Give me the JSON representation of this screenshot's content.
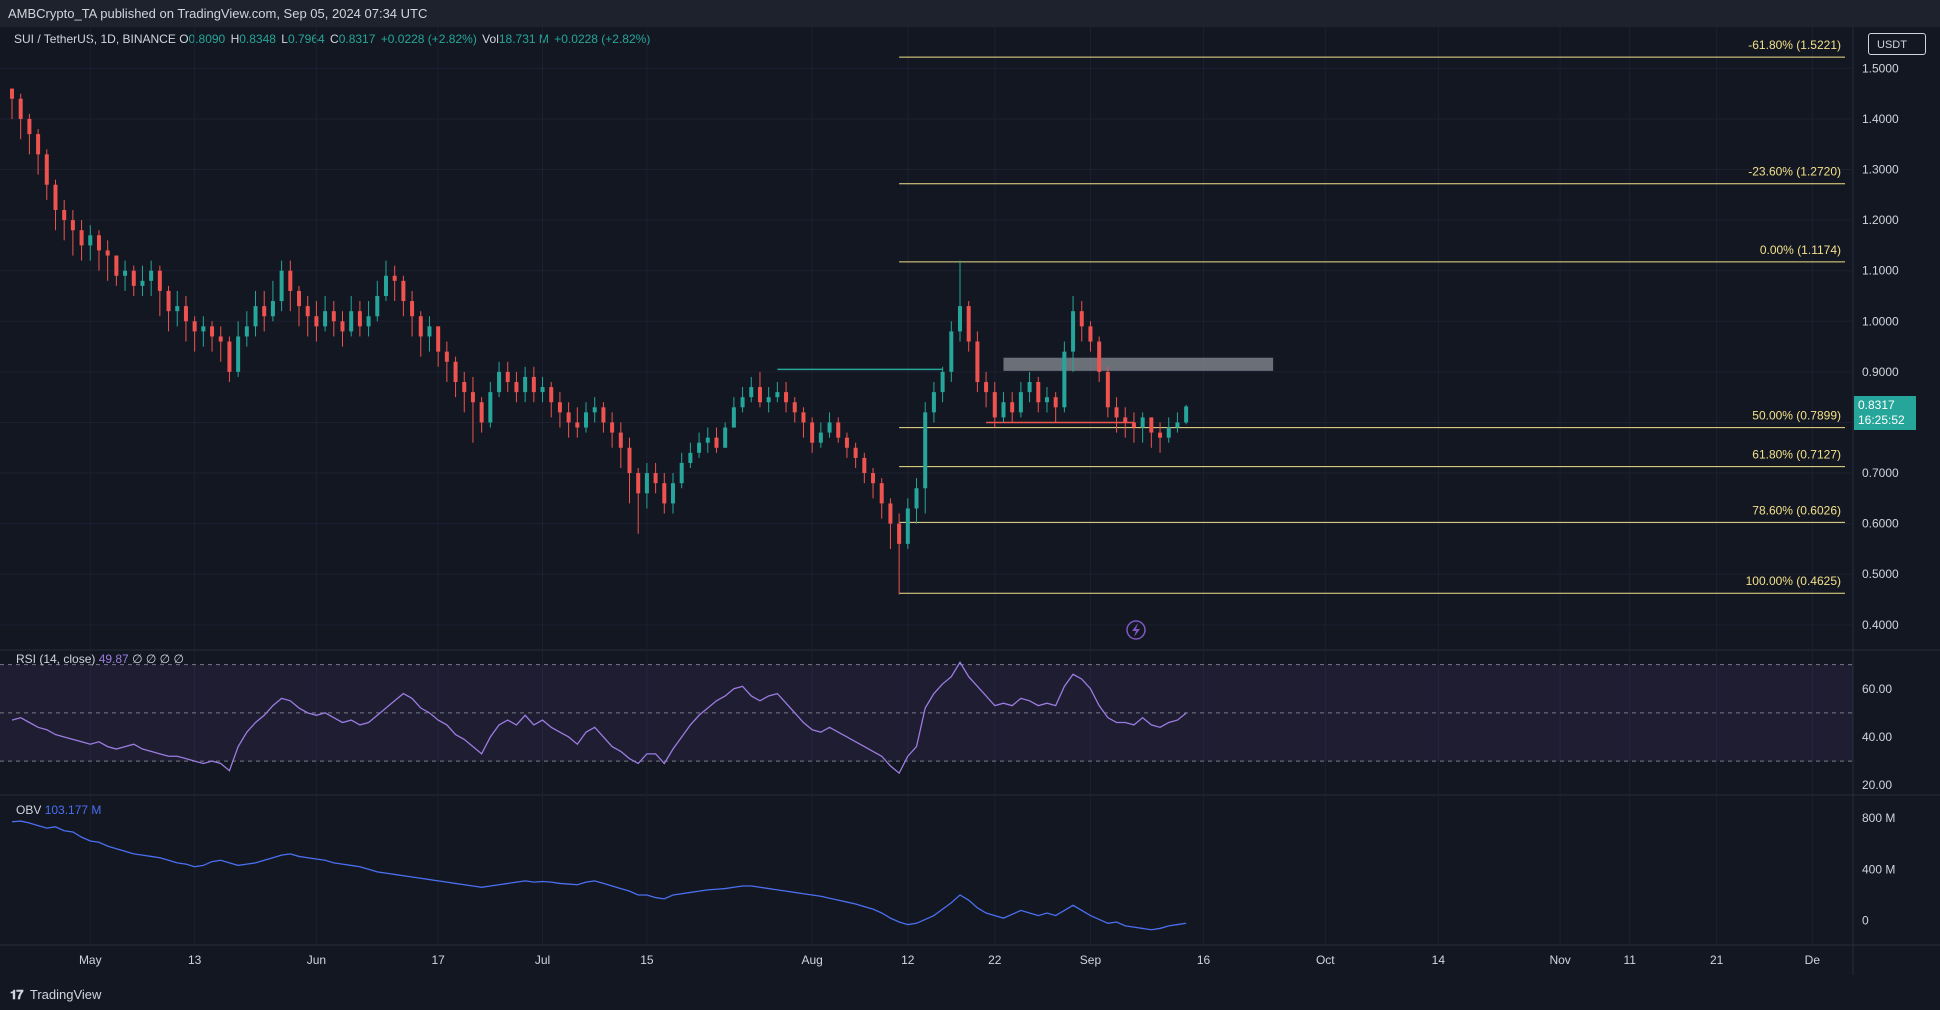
{
  "header": {
    "publisher_line": "AMBCrypto_TA published on TradingView.com, Sep 05, 2024 07:34 UTC"
  },
  "symbol": {
    "name": "SUI / TetherUS, 1D, BINANCE",
    "open_label": "O",
    "open": "0.8090",
    "high_label": "H",
    "high": "0.8348",
    "low_label": "L",
    "low": "0.7964",
    "close_label": "C",
    "close": "0.8317",
    "change": "+0.0228 (+2.82%)",
    "vol_label": "Vol",
    "volume": "18.731 M",
    "vol_change": "+0.0228 (+2.82%)"
  },
  "currency_button": "USDT",
  "last_price": {
    "price": "0.8317",
    "countdown": "16:25:52"
  },
  "rsi": {
    "label": "RSI (14, close)",
    "value": "49.87",
    "extra": "∅ ∅ ∅ ∅"
  },
  "obv": {
    "label": "OBV",
    "value": "103.177 M"
  },
  "footer": {
    "brand": "TradingView",
    "logo_glyph": "𝟏𝟕"
  },
  "colors": {
    "background": "#131722",
    "up": "#26a69a",
    "down": "#ef5350",
    "fib": "#f2e08a",
    "rsi": "#9b7ce0",
    "obv": "#4a6ff0"
  },
  "chart_data": {
    "type": "candlestick",
    "price_axis": {
      "ylim": [
        0.37,
        1.56
      ],
      "ticks": [
        "0.4000",
        "0.5000",
        "0.6000",
        "0.7000",
        "0.8000",
        "0.9000",
        "1.0000",
        "1.1000",
        "1.2000",
        "1.3000",
        "1.4000",
        "1.5000"
      ]
    },
    "time_axis": {
      "xlim": [
        0,
        200
      ],
      "ticks": [
        {
          "t": 9,
          "label": "May"
        },
        {
          "t": 21,
          "label": "13"
        },
        {
          "t": 35,
          "label": "Jun"
        },
        {
          "t": 49,
          "label": "17"
        },
        {
          "t": 61,
          "label": "Jul"
        },
        {
          "t": 73,
          "label": "15"
        },
        {
          "t": 92,
          "label": "Aug"
        },
        {
          "t": 103,
          "label": "12"
        },
        {
          "t": 113,
          "label": "22"
        },
        {
          "t": 124,
          "label": "Sep"
        },
        {
          "t": 137,
          "label": "16"
        },
        {
          "t": 151,
          "label": "Oct"
        },
        {
          "t": 164,
          "label": "14"
        },
        {
          "t": 178,
          "label": "Nov"
        },
        {
          "t": 186,
          "label": "11"
        },
        {
          "t": 196,
          "label": "21"
        },
        {
          "t": 207,
          "label": "De"
        }
      ]
    },
    "close": [
      1.44,
      1.4,
      1.37,
      1.33,
      1.27,
      1.22,
      1.2,
      1.18,
      1.15,
      1.17,
      1.14,
      1.13,
      1.09,
      1.1,
      1.07,
      1.08,
      1.1,
      1.06,
      1.02,
      1.03,
      1.0,
      0.98,
      0.99,
      0.97,
      0.96,
      0.9,
      0.97,
      0.99,
      1.03,
      1.01,
      1.04,
      1.1,
      1.06,
      1.03,
      1.01,
      0.99,
      1.02,
      1.0,
      0.98,
      1.02,
      0.99,
      1.01,
      1.05,
      1.09,
      1.08,
      1.04,
      1.01,
      0.97,
      0.99,
      0.94,
      0.92,
      0.88,
      0.86,
      0.84,
      0.8,
      0.86,
      0.9,
      0.88,
      0.86,
      0.89,
      0.86,
      0.87,
      0.84,
      0.82,
      0.8,
      0.79,
      0.82,
      0.83,
      0.8,
      0.78,
      0.75,
      0.7,
      0.66,
      0.7,
      0.68,
      0.64,
      0.68,
      0.72,
      0.74,
      0.76,
      0.77,
      0.75,
      0.79,
      0.83,
      0.85,
      0.87,
      0.84,
      0.85,
      0.86,
      0.84,
      0.82,
      0.8,
      0.76,
      0.78,
      0.8,
      0.77,
      0.75,
      0.73,
      0.7,
      0.68,
      0.64,
      0.6,
      0.56,
      0.63,
      0.67,
      0.82,
      0.86,
      0.9,
      0.98,
      1.03,
      0.96,
      0.88,
      0.86,
      0.81,
      0.84,
      0.82,
      0.86,
      0.88,
      0.84,
      0.85,
      0.83,
      0.94,
      1.02,
      0.99,
      0.96,
      0.9,
      0.83,
      0.81,
      0.8,
      0.79,
      0.81,
      0.78,
      0.77,
      0.79,
      0.8,
      0.8317
    ],
    "high": [
      1.46,
      1.45,
      1.41,
      1.38,
      1.34,
      1.28,
      1.24,
      1.22,
      1.2,
      1.19,
      1.18,
      1.16,
      1.13,
      1.12,
      1.11,
      1.11,
      1.12,
      1.11,
      1.07,
      1.06,
      1.05,
      1.01,
      1.01,
      1.0,
      0.99,
      0.97,
      1.0,
      1.02,
      1.06,
      1.06,
      1.08,
      1.12,
      1.12,
      1.07,
      1.05,
      1.04,
      1.05,
      1.04,
      1.02,
      1.05,
      1.04,
      1.04,
      1.08,
      1.12,
      1.11,
      1.09,
      1.06,
      1.02,
      1.01,
      0.99,
      0.96,
      0.93,
      0.9,
      0.89,
      0.85,
      0.88,
      0.92,
      0.92,
      0.9,
      0.91,
      0.91,
      0.89,
      0.88,
      0.86,
      0.84,
      0.83,
      0.84,
      0.85,
      0.84,
      0.82,
      0.8,
      0.77,
      0.71,
      0.72,
      0.72,
      0.7,
      0.7,
      0.74,
      0.76,
      0.78,
      0.79,
      0.79,
      0.8,
      0.85,
      0.87,
      0.89,
      0.9,
      0.87,
      0.88,
      0.88,
      0.85,
      0.83,
      0.81,
      0.8,
      0.82,
      0.81,
      0.78,
      0.76,
      0.74,
      0.71,
      0.69,
      0.65,
      0.62,
      0.65,
      0.69,
      0.84,
      0.88,
      0.91,
      1.0,
      1.12,
      1.04,
      0.98,
      0.9,
      0.88,
      0.86,
      0.86,
      0.88,
      0.9,
      0.89,
      0.87,
      0.86,
      0.96,
      1.05,
      1.04,
      1.0,
      0.97,
      0.91,
      0.85,
      0.83,
      0.82,
      0.82,
      0.81,
      0.8,
      0.81,
      0.82,
      0.8348
    ],
    "low": [
      1.4,
      1.36,
      1.33,
      1.29,
      1.24,
      1.18,
      1.16,
      1.13,
      1.12,
      1.12,
      1.1,
      1.08,
      1.07,
      1.06,
      1.05,
      1.05,
      1.05,
      1.01,
      0.98,
      0.99,
      0.96,
      0.94,
      0.95,
      0.94,
      0.92,
      0.88,
      0.89,
      0.95,
      0.97,
      0.98,
      1.0,
      1.02,
      1.02,
      0.99,
      0.97,
      0.96,
      0.98,
      0.97,
      0.95,
      0.97,
      0.97,
      0.97,
      1.0,
      1.04,
      1.04,
      1.01,
      0.97,
      0.93,
      0.94,
      0.91,
      0.88,
      0.85,
      0.82,
      0.76,
      0.78,
      0.79,
      0.85,
      0.86,
      0.84,
      0.84,
      0.84,
      0.84,
      0.81,
      0.79,
      0.77,
      0.77,
      0.78,
      0.8,
      0.78,
      0.75,
      0.71,
      0.64,
      0.58,
      0.63,
      0.66,
      0.62,
      0.62,
      0.67,
      0.71,
      0.73,
      0.74,
      0.74,
      0.75,
      0.79,
      0.82,
      0.84,
      0.83,
      0.82,
      0.84,
      0.82,
      0.8,
      0.77,
      0.74,
      0.75,
      0.77,
      0.76,
      0.73,
      0.71,
      0.68,
      0.65,
      0.61,
      0.55,
      0.46,
      0.55,
      0.6,
      0.62,
      0.8,
      0.84,
      0.88,
      0.96,
      0.94,
      0.86,
      0.83,
      0.79,
      0.8,
      0.8,
      0.81,
      0.84,
      0.82,
      0.82,
      0.8,
      0.82,
      0.9,
      0.96,
      0.94,
      0.88,
      0.81,
      0.78,
      0.77,
      0.76,
      0.76,
      0.75,
      0.74,
      0.76,
      0.78,
      0.7964
    ],
    "fibonacci": [
      {
        "label": "-61.80% (1.5221)",
        "price": 1.5221
      },
      {
        "label": "-23.60% (1.2720)",
        "price": 1.272
      },
      {
        "label": "0.00% (1.1174)",
        "price": 1.1174
      },
      {
        "label": "50.00% (0.7899)",
        "price": 0.7899
      },
      {
        "label": "61.80% (0.7127)",
        "price": 0.7127
      },
      {
        "label": "78.60% (0.6026)",
        "price": 0.6026
      },
      {
        "label": "100.00% (0.4625)",
        "price": 0.4625
      }
    ],
    "fib_start_t": 102,
    "fib_end_t": 213,
    "supply_zone": {
      "t0": 114,
      "t1": 145,
      "p0": 0.902,
      "p1": 0.928
    },
    "green_level": {
      "t0": 88,
      "t1": 107,
      "price": 0.905
    },
    "red_level": {
      "t0": 112,
      "t1": 129,
      "price": 0.8
    },
    "rsi_axis": {
      "ylim": [
        18,
        74
      ],
      "ticks": [
        "20.00",
        "40.00",
        "60.00"
      ],
      "bands": [
        30,
        50,
        70
      ]
    },
    "rsi_values": [
      47,
      48,
      46,
      44,
      43,
      41,
      40,
      39,
      38,
      37,
      38,
      36,
      35,
      36,
      37,
      35,
      34,
      33,
      32,
      32,
      31,
      30,
      29,
      30,
      29,
      26,
      36,
      42,
      46,
      49,
      53,
      56,
      55,
      52,
      50,
      49,
      50,
      48,
      46,
      47,
      45,
      46,
      49,
      52,
      55,
      58,
      56,
      52,
      50,
      47,
      45,
      41,
      39,
      36,
      33,
      40,
      45,
      47,
      45,
      49,
      45,
      47,
      44,
      42,
      40,
      37,
      42,
      44,
      40,
      36,
      34,
      31,
      29,
      33,
      33,
      29,
      35,
      40,
      45,
      49,
      52,
      55,
      57,
      60,
      61,
      57,
      55,
      57,
      58,
      54,
      50,
      46,
      43,
      42,
      44,
      42,
      40,
      38,
      36,
      34,
      32,
      28,
      25,
      32,
      36,
      52,
      58,
      62,
      65,
      71,
      65,
      61,
      57,
      53,
      54,
      53,
      56,
      55,
      53,
      54,
      53,
      61,
      66,
      64,
      60,
      53,
      48,
      46,
      46,
      45,
      48,
      45,
      44,
      46,
      47,
      49.87
    ],
    "obv_axis": {
      "ylim": [
        -150,
        900
      ],
      "ticks": [
        "0",
        "400 M",
        "800 M"
      ]
    },
    "obv_values": [
      770,
      775,
      760,
      740,
      720,
      730,
      700,
      690,
      650,
      620,
      610,
      580,
      560,
      540,
      520,
      510,
      500,
      490,
      470,
      450,
      440,
      420,
      430,
      460,
      470,
      450,
      430,
      440,
      450,
      470,
      490,
      510,
      520,
      500,
      490,
      480,
      470,
      450,
      440,
      430,
      420,
      400,
      380,
      370,
      360,
      350,
      340,
      330,
      320,
      310,
      300,
      290,
      280,
      270,
      260,
      270,
      280,
      290,
      300,
      310,
      300,
      305,
      300,
      290,
      285,
      280,
      300,
      310,
      290,
      270,
      250,
      230,
      200,
      200,
      180,
      170,
      200,
      210,
      220,
      230,
      240,
      245,
      250,
      260,
      270,
      270,
      260,
      250,
      240,
      230,
      220,
      210,
      200,
      190,
      175,
      160,
      145,
      130,
      110,
      90,
      60,
      20,
      -10,
      -30,
      -20,
      10,
      40,
      90,
      140,
      200,
      160,
      100,
      60,
      40,
      20,
      50,
      80,
      60,
      40,
      60,
      40,
      80,
      120,
      80,
      40,
      10,
      -20,
      -10,
      -40,
      -50,
      -60,
      -70,
      -60,
      -40,
      -30,
      -20
    ]
  }
}
